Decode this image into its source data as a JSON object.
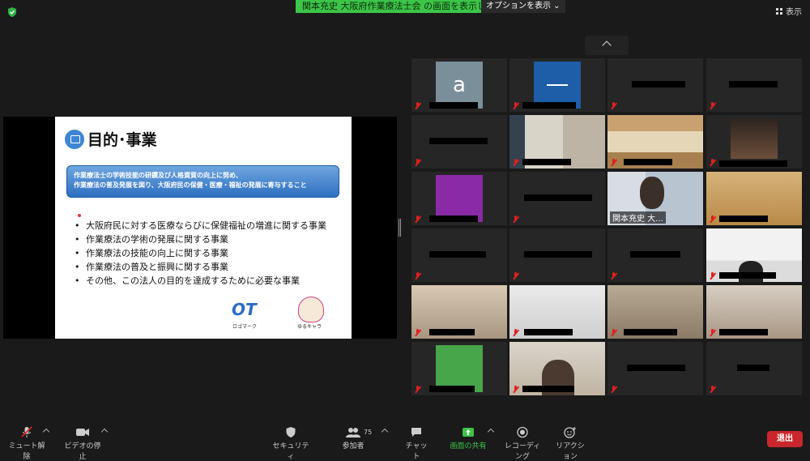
{
  "top_bar": {
    "share_banner": "関本充史 大阪府作業療法士会 の画面を表示しています",
    "options_button": "オプションを表示 ⌄",
    "view_button": "表示"
  },
  "slide": {
    "title": "目的･事業",
    "banner_line1": "作業療法士の学術技能の研鑽及び人格資質の向上に努め、",
    "banner_line2": "作業療法の普及発展を図り、大阪府民の保健・医療・福祉の発展に寄与すること",
    "items": [
      "大阪府民に対する医療ならびに保健福祉の増進に関する事業",
      "作業療法の学術の発展に関する事業",
      "作業療法の技能の向上に関する事業",
      "作業療法の普及と振興に関する事業",
      "その他、この法人の目的を達成するために必要な事業"
    ],
    "logo_text": "OT",
    "logo_caption": "ロゴマーク",
    "mascot_caption": "ゆるキャラ"
  },
  "gallery": {
    "avatar_a_letter": "a",
    "active_speaker_name": "関本充史 大..."
  },
  "toolbar": {
    "mute": "ミュート解除",
    "video": "ビデオの停止",
    "security": "セキュリティ",
    "participants": "参加者",
    "participants_count": "75",
    "chat": "チャット",
    "share": "画面の共有",
    "record": "レコーディング",
    "reactions": "リアクション",
    "leave": "退出"
  },
  "colors": {
    "share_green": "#3cc548",
    "leave_red": "#c9272d",
    "active_border": "#c8d94a",
    "muted_red": "#e02020"
  }
}
